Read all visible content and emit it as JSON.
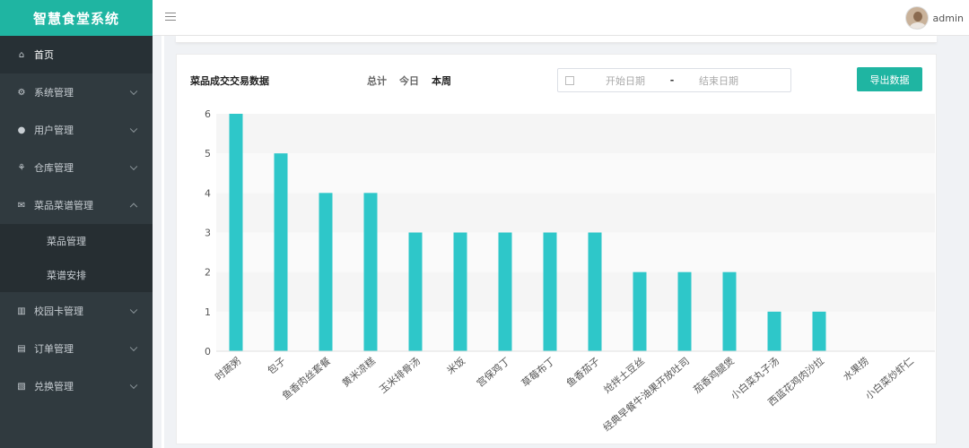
{
  "app": {
    "title": "智慧食堂系统"
  },
  "sidebar": {
    "items": [
      {
        "label": "首页",
        "icon": "home-icon",
        "glyph": "⌂",
        "active": true
      },
      {
        "label": "系统管理",
        "icon": "gear-icon",
        "glyph": "⚙"
      },
      {
        "label": "用户管理",
        "icon": "user-icon",
        "glyph": "●"
      },
      {
        "label": "仓库管理",
        "icon": "warehouse-icon",
        "glyph": "⚘"
      },
      {
        "label": "菜品菜谱管理",
        "icon": "mail-icon",
        "glyph": "✉",
        "expanded": true,
        "children": [
          {
            "label": "菜品管理"
          },
          {
            "label": "菜谱安排"
          }
        ]
      },
      {
        "label": "校园卡管理",
        "icon": "bar-chart-icon",
        "glyph": "▥"
      },
      {
        "label": "订单管理",
        "icon": "document-icon",
        "glyph": "▤"
      },
      {
        "label": "兑换管理",
        "icon": "exchange-icon",
        "glyph": "▧"
      }
    ]
  },
  "header": {
    "user": "admin"
  },
  "panel": {
    "title": "菜品成交交易数据",
    "filters": [
      "总计",
      "今日",
      "本周"
    ],
    "active_filter": "本周",
    "date_start_placeholder": "开始日期",
    "date_separator": "-",
    "date_end_placeholder": "结束日期",
    "export_label": "导出数据"
  },
  "colors": {
    "accent": "#1fb5a2",
    "bar": "#2ec7c9",
    "sidebar": "#303a3f"
  },
  "chart_data": {
    "type": "bar",
    "categories": [
      "时蔬粥",
      "包子",
      "鱼香肉丝套餐",
      "黄米凉糕",
      "玉米排骨汤",
      "米饭",
      "宫保鸡丁",
      "草莓布丁",
      "鱼香茄子",
      "炝拌土豆丝",
      "经典早餐牛油果开放吐司",
      "茄香鸡腿煲",
      "小白菜丸子汤",
      "西蓝花鸡肉沙拉",
      "水果捞",
      "小白菜炒虾仁"
    ],
    "values": [
      6,
      5,
      4,
      4,
      3,
      3,
      3,
      3,
      3,
      2,
      2,
      2,
      1,
      1,
      0,
      0
    ],
    "ylim": [
      0,
      6
    ],
    "yticks": [
      0,
      1,
      2,
      3,
      4,
      5,
      6
    ],
    "grid": "horizontal striped bands",
    "title": "",
    "xlabel": "",
    "ylabel": ""
  }
}
